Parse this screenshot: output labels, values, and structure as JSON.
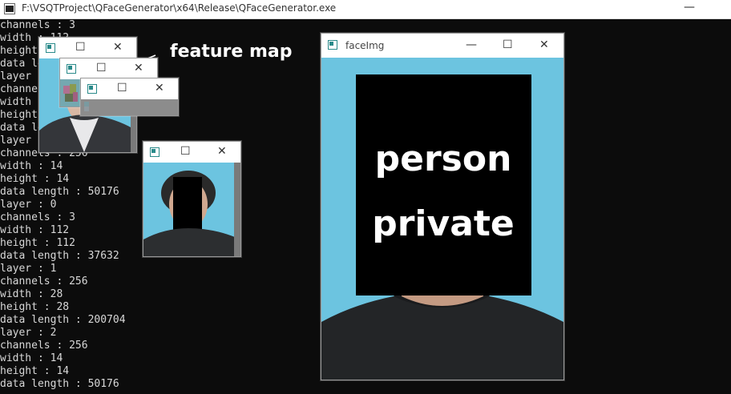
{
  "window": {
    "title": "F:\\VSQTProject\\QFaceGenerator\\x64\\Release\\QFaceGenerator.exe",
    "minimize_glyph": "—"
  },
  "console": {
    "lines": [
      "channels : 3",
      "width : 112",
      "height : 112",
      "data le",
      "layer :",
      "channel",
      "width :",
      "height :",
      "data le",
      "layer :",
      "channels : 256",
      "width : 14",
      "height : 14",
      "data length : 50176",
      "layer : 0",
      "channels : 3",
      "width : 112",
      "height : 112",
      "data length : 37632",
      "layer : 1",
      "channels : 256",
      "width : 28",
      "height : 28",
      "data length : 200704",
      "layer : 2",
      "channels : 256",
      "width : 14",
      "height : 14",
      "data length : 50176"
    ]
  },
  "annotation": {
    "feature_label": "feature map"
  },
  "cv_windows": {
    "controls": {
      "minimize": "—",
      "maximize": "☐",
      "close": "✕"
    }
  },
  "face_window": {
    "title": "faceImg",
    "controls": {
      "minimize": "—",
      "maximize": "☐",
      "close": "✕"
    },
    "privacy_line1": "person",
    "privacy_line2": "private"
  },
  "colors": {
    "console_bg": "#0c0c0c",
    "console_text": "#d8d8d8",
    "photo_bg": "#6cc4e0",
    "privacy_box": "#000000"
  }
}
